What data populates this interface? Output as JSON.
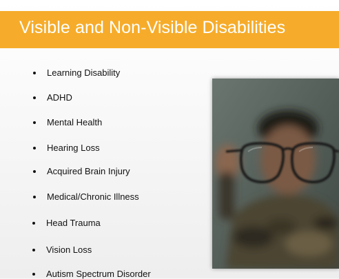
{
  "slide": {
    "title": "Visible and Non-Visible Disabilities",
    "bullets": [
      "Learning Disability",
      "ADHD",
      "Mental Health",
      "Hearing Loss",
      "Acquired Brain Injury",
      "Medical/Chronic Illness",
      "Head Trauma",
      "Vision Loss",
      "Autism Spectrum Disorder"
    ]
  },
  "colors": {
    "title_bar": "#f6ac2a",
    "title_text": "#ffffff",
    "body_text": "#111111"
  },
  "photo": {
    "icon": "person-holding-eyeglasses-photo"
  }
}
